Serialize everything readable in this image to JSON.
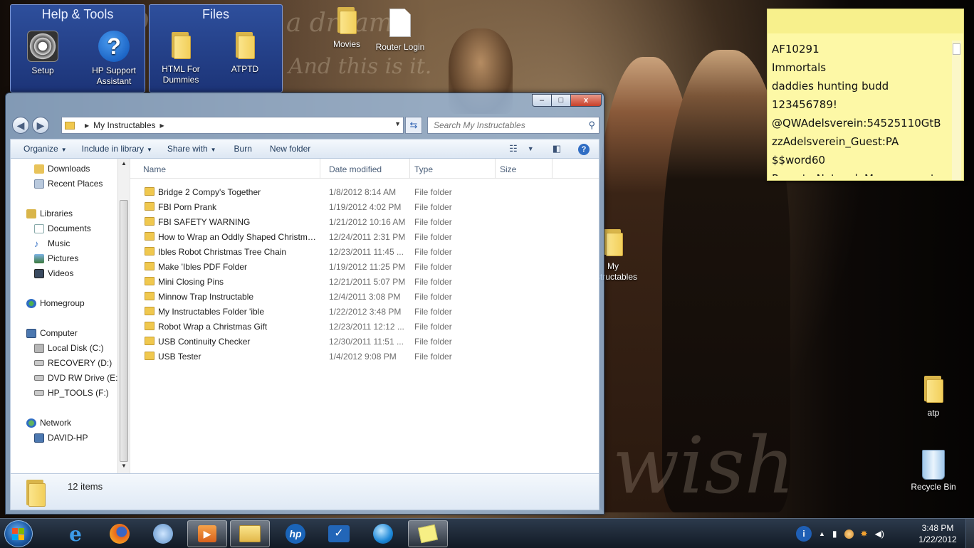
{
  "desktop": {
    "wallpaper_text_1": "Once, I had a dream.",
    "wallpaper_text_2": "And this is it.",
    "wallpaper_text_3": "wish",
    "gadgets": [
      {
        "title": "Help & Tools",
        "icons": [
          {
            "label": "Setup"
          },
          {
            "label": "HP Support Assistant"
          }
        ]
      },
      {
        "title": "Files",
        "icons": [
          {
            "label": "HTML For Dummies"
          },
          {
            "label": "ATPTD"
          }
        ]
      }
    ],
    "icons": [
      {
        "label": "Movies"
      },
      {
        "label": "Router Login"
      },
      {
        "label": "My Instructables"
      },
      {
        "label": "atp"
      },
      {
        "label": "Recycle Bin"
      }
    ]
  },
  "sticky_note": {
    "lines": [
      "AF10291",
      "Immortals",
      "daddies hunting budd",
      "123456789!",
      "@QWAdelsverein:54525110GtB",
      "zzAdelsverein_Guest:PA",
      "$$word60",
      "Remote Network Management"
    ]
  },
  "explorer": {
    "window_controls": {
      "minimize": "–",
      "maximize": "□",
      "close": "x"
    },
    "address": {
      "segment": "My Instructables"
    },
    "search": {
      "placeholder": "Search My Instructables"
    },
    "toolbar": {
      "organize": "Organize",
      "include_in_library": "Include in library",
      "share_with": "Share with",
      "burn": "Burn",
      "new_folder": "New folder"
    },
    "nav": {
      "downloads": "Downloads",
      "recent_places": "Recent Places",
      "libraries": "Libraries",
      "documents": "Documents",
      "music": "Music",
      "pictures": "Pictures",
      "videos": "Videos",
      "homegroup": "Homegroup",
      "computer": "Computer",
      "local_disk": "Local Disk (C:)",
      "recovery": "RECOVERY (D:)",
      "dvd": "DVD RW Drive (E:",
      "hp_tools": "HP_TOOLS (F:)",
      "network": "Network",
      "david_hp": "DAVID-HP"
    },
    "columns": {
      "name": "Name",
      "date_modified": "Date modified",
      "type": "Type",
      "size": "Size"
    },
    "files": [
      {
        "name": "Bridge 2 Compy's Together",
        "date": "1/8/2012 8:14 AM",
        "type": "File folder"
      },
      {
        "name": "FBI Porn Prank",
        "date": "1/19/2012 4:02 PM",
        "type": "File folder"
      },
      {
        "name": "FBI SAFETY WARNING",
        "date": "1/21/2012 10:16 AM",
        "type": "File folder"
      },
      {
        "name": "How to Wrap an Oddly Shaped Christma...",
        "date": "12/24/2011 2:31 PM",
        "type": "File folder"
      },
      {
        "name": "Ibles Robot Christmas Tree Chain",
        "date": "12/23/2011 11:45 ...",
        "type": "File folder"
      },
      {
        "name": "Make 'Ibles PDF Folder",
        "date": "1/19/2012 11:25 PM",
        "type": "File folder"
      },
      {
        "name": "Mini Closing Pins",
        "date": "12/21/2011 5:07 PM",
        "type": "File folder"
      },
      {
        "name": "Minnow Trap Instructable",
        "date": "12/4/2011 3:08 PM",
        "type": "File folder"
      },
      {
        "name": "My Instructables Folder 'ible",
        "date": "1/22/2012 3:48 PM",
        "type": "File folder"
      },
      {
        "name": "Robot Wrap a Christmas Gift",
        "date": "12/23/2011 12:12 ...",
        "type": "File folder"
      },
      {
        "name": "USB Continuity Checker",
        "date": "12/30/2011 11:51 ...",
        "type": "File folder"
      },
      {
        "name": "USB Tester",
        "date": "1/4/2012 9:08 PM",
        "type": "File folder"
      }
    ],
    "status": {
      "item_count": "12 items"
    }
  },
  "taskbar": {
    "clock_time": "3:48 PM",
    "clock_date": "1/22/2012"
  }
}
